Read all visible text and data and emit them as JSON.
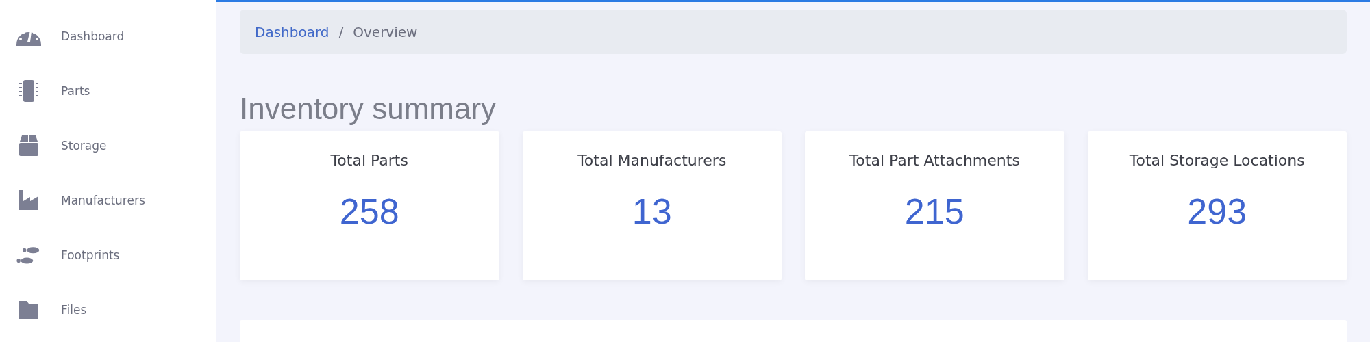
{
  "sidebar": {
    "items": [
      {
        "label": "Dashboard"
      },
      {
        "label": "Parts"
      },
      {
        "label": "Storage"
      },
      {
        "label": "Manufacturers"
      },
      {
        "label": "Footprints"
      },
      {
        "label": "Files"
      }
    ]
  },
  "breadcrumb": [
    {
      "label": "Dashboard",
      "kind": "link"
    },
    {
      "label": "/",
      "kind": "separator"
    },
    {
      "label": "Overview",
      "kind": "current"
    }
  ],
  "heading": "Inventory summary",
  "stats": [
    {
      "title": "Total Parts",
      "value": "258"
    },
    {
      "title": "Total Manufacturers",
      "value": "13"
    },
    {
      "title": "Total Part Attachments",
      "value": "215"
    },
    {
      "title": "Total Storage Locations",
      "value": "293"
    }
  ]
}
